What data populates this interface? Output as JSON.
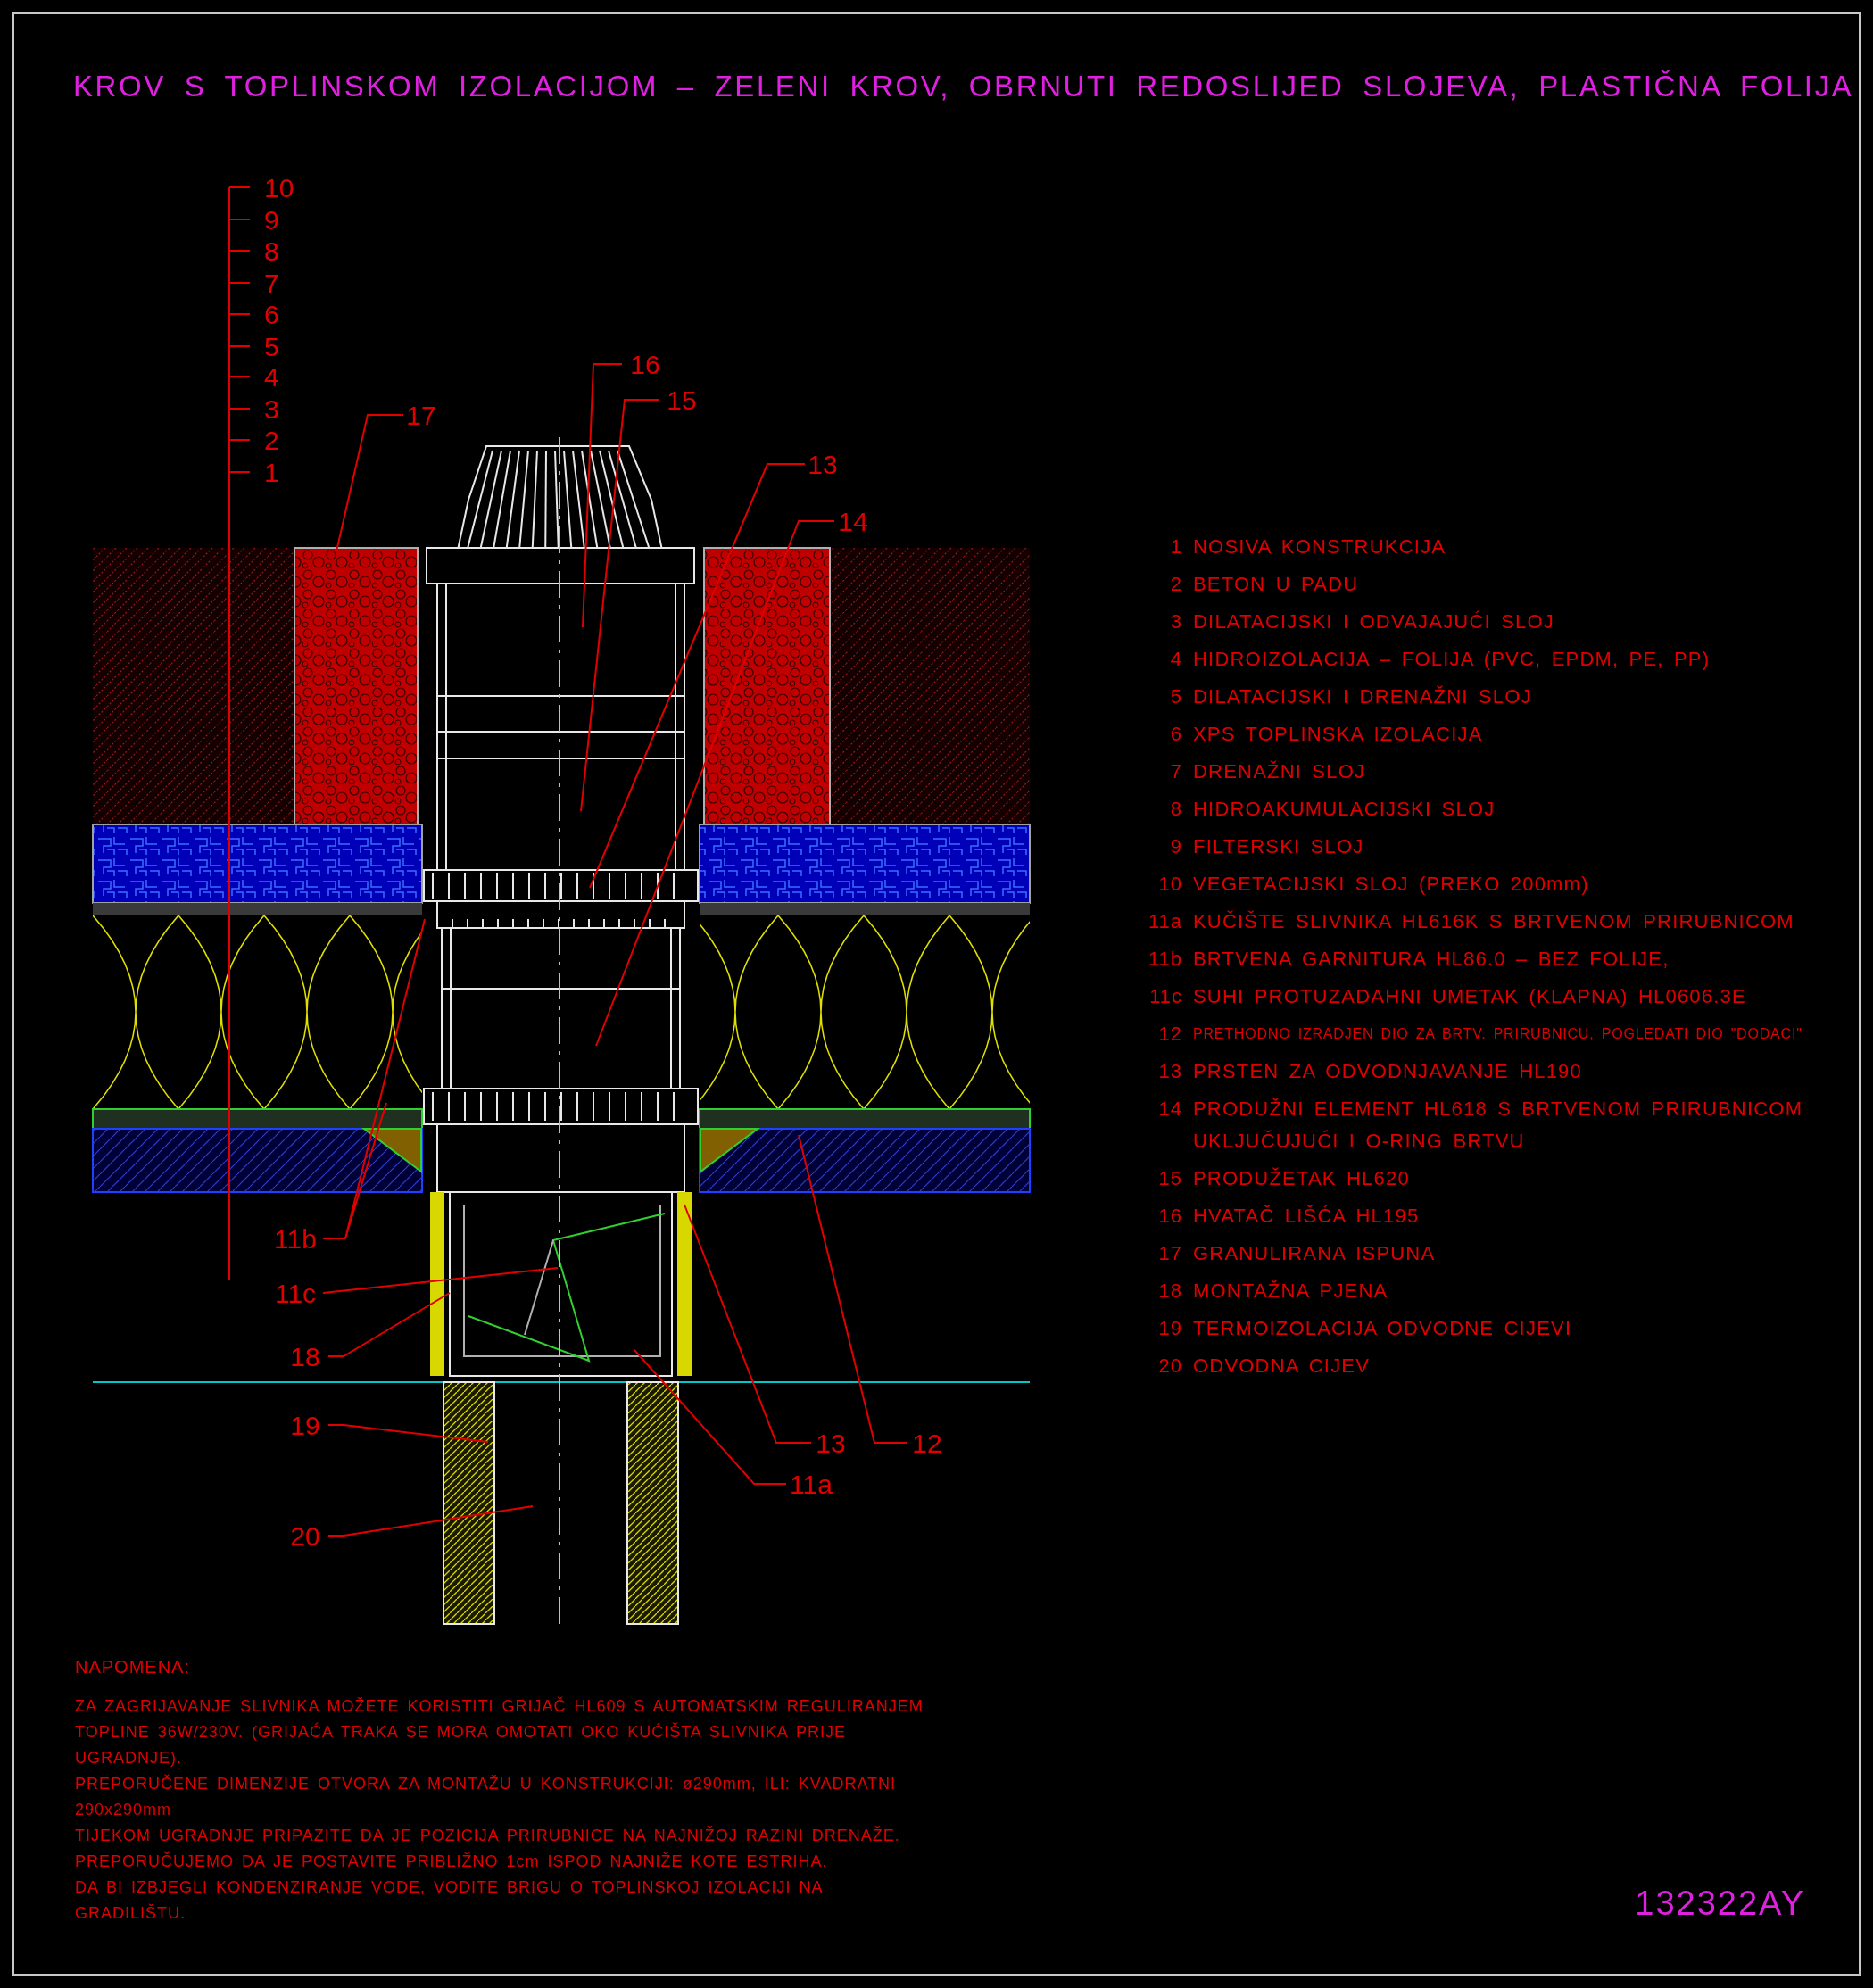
{
  "title": "KROV S TOPLINSKOM IZOLACIJOM – ZELENI KROV, OBRNUTI REDOSLIJED SLOJEVA, PLASTIČNA FOLIJA",
  "drawing": {
    "scale_labels": [
      "10",
      "9",
      "8",
      "7",
      "6",
      "5",
      "4",
      "3",
      "2",
      "1"
    ],
    "callouts": [
      {
        "label": "16"
      },
      {
        "label": "15"
      },
      {
        "label": "13"
      },
      {
        "label": "17"
      },
      {
        "label": "14"
      },
      {
        "label": "11b"
      },
      {
        "label": "11c"
      },
      {
        "label": "18"
      },
      {
        "label": "19"
      },
      {
        "label": "20"
      },
      {
        "label": "13"
      },
      {
        "label": "12"
      },
      {
        "label": "11a"
      }
    ]
  },
  "legend": [
    {
      "number": "1",
      "text": "NOSIVA KONSTRUKCIJA",
      "kind": "normal"
    },
    {
      "number": "2",
      "text": "BETON U PADU",
      "kind": "normal"
    },
    {
      "number": "3",
      "text": "DILATACIJSKI I ODVAJAJUĆI SLOJ",
      "kind": "normal"
    },
    {
      "number": "4",
      "text": "HIDROIZOLACIJA – FOLIJA (PVC, EPDM, PE, PP)",
      "kind": "normal"
    },
    {
      "number": "5",
      "text": "DILATACIJSKI I DRENAŽNI SLOJ",
      "kind": "normal"
    },
    {
      "number": "6",
      "text": "XPS TOPLINSKA IZOLACIJA",
      "kind": "normal"
    },
    {
      "number": "7",
      "text": "DRENAŽNI SLOJ",
      "kind": "normal"
    },
    {
      "number": "8",
      "text": "HIDROAKUMULACIJSKI SLOJ",
      "kind": "normal"
    },
    {
      "number": "9",
      "text": "FILTERSKI SLOJ",
      "kind": "normal"
    },
    {
      "number": "10",
      "text": "VEGETACIJSKI SLOJ (PREKO 200mm)",
      "kind": "normal"
    },
    {
      "number": "11a",
      "text": "KUČIŠTE SLIVNIKA HL616K S BRTVENOM PRIRUBNICOM",
      "kind": "normal"
    },
    {
      "number": "11b",
      "text": "BRTVENA GARNITURA HL86.0 – BEZ FOLIJE,",
      "kind": "normal"
    },
    {
      "number": "11c",
      "text": "SUHI PROTUZADAHNI UMETAK (KLAPNA) HL0606.3E",
      "kind": "normal"
    },
    {
      "number": "12",
      "text": "PRETHODNO IZRADJEN DIO ZA BRTV. PRIRUBNICU, POGLEDATI DIO \"DODACI\"",
      "kind": "compact"
    },
    {
      "number": "13",
      "text": "PRSTEN ZA ODVODNJAVANJE HL190",
      "kind": "normal"
    },
    {
      "number": "14",
      "text": "PRODUŽNI ELEMENT HL618 S BRTVENOM PRIRUBNICOM UKLJUČUJUĆI I O-RING BRTVU",
      "kind": "normal"
    },
    {
      "number": "15",
      "text": "PRODUŽETAK HL620",
      "kind": "normal"
    },
    {
      "number": "16",
      "text": "HVATAČ LIŠĆA HL195",
      "kind": "normal"
    },
    {
      "number": "17",
      "text": "GRANULIRANA ISPUNA",
      "kind": "normal"
    },
    {
      "number": "18",
      "text": "MONTAŽNA PJENA",
      "kind": "normal"
    },
    {
      "number": "19",
      "text": "TERMOIZOLACIJA ODVODNE CIJEVI",
      "kind": "normal"
    },
    {
      "number": "20",
      "text": "ODVODNA CIJEV",
      "kind": "normal"
    }
  ],
  "notes": {
    "heading": "NAPOMENA:",
    "paragraphs": [
      "ZA ZAGRIJAVANJE SLIVNIKA MOŽETE KORISTITI GRIJAČ HL609 S AUTOMATSKIM REGULIRANJEM TOPLINE 36W/230V. (GRIJAĆA TRAKA SE MORA OMOTATI OKO KUĆIŠTA SLIVNIKA PRIJE UGRADNJE).",
      "PREPORUČENE DIMENZIJE OTVORA ZA MONTAŽU U KONSTRUKCIJI: ø290mm, ILI: KVADRATNI 290x290mm",
      "TIJEKOM UGRADNJE PRIPAZITE DA JE POZICIJA PRIRUBNICE NA NAJNIŽOJ RAZINI DRENAŽE.",
      "PREPORUČUJEMO DA JE POSTAVITE PRIBLIŽNO 1cm ISPOD NAJNIŽE KOTE ESTRIHA.",
      "DA BI IZBJEGLI KONDENZIRANJE VODE, VODITE BRIGU O TOPLINSKOJ IZOLACIJI NA GRADILIŠTU."
    ]
  },
  "drawing_code": "132322AY"
}
